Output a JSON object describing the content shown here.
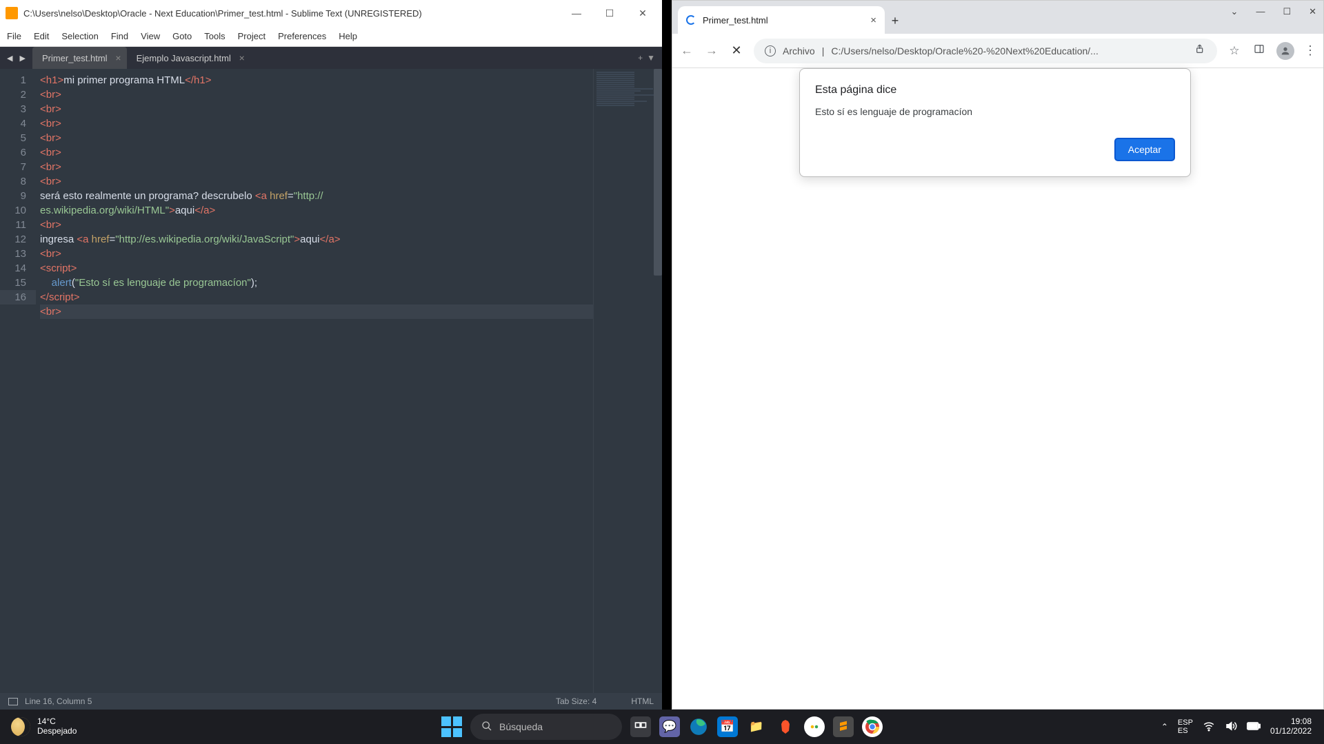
{
  "sublime": {
    "title": "C:\\Users\\nelso\\Desktop\\Oracle - Next Education\\Primer_test.html - Sublime Text (UNREGISTERED)",
    "menu": [
      "File",
      "Edit",
      "Selection",
      "Find",
      "View",
      "Goto",
      "Tools",
      "Project",
      "Preferences",
      "Help"
    ],
    "tabs": [
      {
        "label": "Primer_test.html",
        "active": true
      },
      {
        "label": "Ejemplo Javascript.html",
        "active": false
      }
    ],
    "status": {
      "left": "Line 16, Column 5",
      "tabsize": "Tab Size: 4",
      "lang": "HTML"
    },
    "lines": [
      "1",
      "2",
      "3",
      "4",
      "5",
      "6",
      "7",
      "8",
      "9",
      "10",
      "11",
      "12",
      "13",
      "14",
      "15",
      "16"
    ]
  },
  "chrome": {
    "tab_title": "Primer_test.html",
    "addr_prefix": "Archivo",
    "url": "C:/Users/nelso/Desktop/Oracle%20-%20Next%20Education/...",
    "dialog": {
      "title": "Esta página dice",
      "message": "Esto sí es lenguaje de programacíon",
      "ok": "Aceptar"
    }
  },
  "taskbar": {
    "weather_temp": "14°C",
    "weather_desc": "Despejado",
    "search_placeholder": "Búsqueda",
    "lang_top": "ESP",
    "lang_bot": "ES",
    "time": "19:08",
    "date": "01/12/2022"
  },
  "code": {
    "h1_text": "mi primer programa HTML",
    "l9_text": "será esto realmente un programa? descrubelo ",
    "l9_url": "http://",
    "l10_url": "es.wikipedia.org/wiki/HTML",
    "l10_link": "aqui",
    "l11_text": "ingresa ",
    "l11_url": "http://es.wikipedia.org/wiki/JavaScript",
    "l11_link": "aqui",
    "alert_str": "Esto sí es lenguaje de programacíon"
  }
}
